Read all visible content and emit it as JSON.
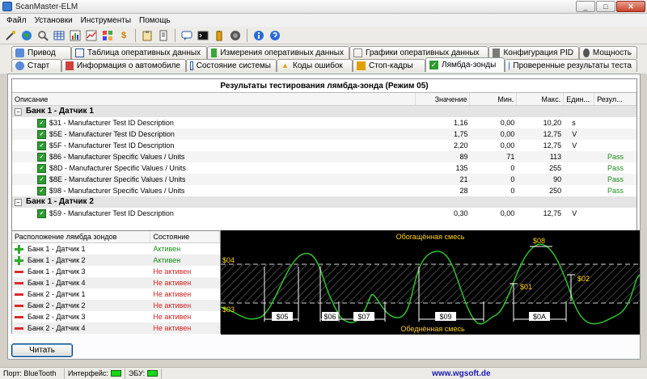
{
  "window": {
    "title": "ScanMaster-ELM",
    "controls": {
      "minimize": "_",
      "maximize": "□",
      "close": "✕"
    }
  },
  "menu": [
    "Файл",
    "Установки",
    "Инструменты",
    "Помощь"
  ],
  "tabs_row1": [
    {
      "label": "Привод",
      "icon": "drive-icon"
    },
    {
      "label": "Таблица оперативных данных",
      "icon": "table-icon"
    },
    {
      "label": "Измерения оперативных данных",
      "icon": "measure-icon"
    },
    {
      "label": "Графики оперативных данных",
      "icon": "chart-icon"
    },
    {
      "label": "Конфигурация PID",
      "icon": "config-icon"
    },
    {
      "label": "Мощность",
      "icon": "power-icon"
    }
  ],
  "tabs_row2": [
    {
      "label": "Старт",
      "icon": "start-icon"
    },
    {
      "label": "Информация о автомобиле",
      "icon": "car-info-icon"
    },
    {
      "label": "Состояние системы",
      "icon": "system-icon"
    },
    {
      "label": "Коды ошибок",
      "icon": "warning-icon"
    },
    {
      "label": "Стоп-кадры",
      "icon": "freeze-frame-icon"
    },
    {
      "label": "Лямбда-зонды",
      "icon": "lambda-icon",
      "active": true
    },
    {
      "label": "Проверенные результаты теста",
      "icon": "test-results-icon"
    }
  ],
  "grid": {
    "title": "Результаты тестирования лямбда-зонда (Режим 05)",
    "columns": {
      "desc": "Описание",
      "value": "Значение",
      "min": "Мин.",
      "max": "Макс.",
      "unit": "Един...",
      "result": "Резул..."
    },
    "groups": [
      {
        "name": "Банк 1 - Датчик 1",
        "expander": "−",
        "rows": [
          {
            "desc": "$31 - Manufacturer Test ID Description",
            "value": "1,16",
            "min": "0,00",
            "max": "10,20",
            "unit": "s",
            "result": ""
          },
          {
            "desc": "$5E - Manufacturer Test ID Description",
            "value": "1,75",
            "min": "0,00",
            "max": "12,75",
            "unit": "V",
            "result": ""
          },
          {
            "desc": "$5F - Manufacturer Test ID Description",
            "value": "2,20",
            "min": "0,00",
            "max": "12,75",
            "unit": "V",
            "result": ""
          },
          {
            "desc": "$86 - Manufacturer Specific Values / Units",
            "value": "89",
            "min": "71",
            "max": "113",
            "unit": "",
            "result": "Pass"
          },
          {
            "desc": "$8D - Manufacturer Specific Values / Units",
            "value": "135",
            "min": "0",
            "max": "255",
            "unit": "",
            "result": "Pass"
          },
          {
            "desc": "$8E - Manufacturer Specific Values / Units",
            "value": "21",
            "min": "0",
            "max": "90",
            "unit": "",
            "result": "Pass"
          },
          {
            "desc": "$98 - Manufacturer Specific Values / Units",
            "value": "28",
            "min": "0",
            "max": "250",
            "unit": "",
            "result": "Pass"
          }
        ]
      },
      {
        "name": "Банк 1 - Датчик 2",
        "expander": "−",
        "rows": [
          {
            "desc": "$59 - Manufacturer Test ID Description",
            "value": "0,30",
            "min": "0,00",
            "max": "12,75",
            "unit": "V",
            "result": ""
          }
        ]
      }
    ]
  },
  "sensors": {
    "headers": {
      "location": "Расположение лямбда зондов",
      "state": "Состояние"
    },
    "rows": [
      {
        "name": "Банк 1 - Датчик 1",
        "state": "Активен",
        "active": true
      },
      {
        "name": "Банк 1 - Датчик 2",
        "state": "Активен",
        "active": true
      },
      {
        "name": "Банк 1 - Датчик 3",
        "state": "Не активен",
        "active": false
      },
      {
        "name": "Банк 1 - Датчик 4",
        "state": "Не активен",
        "active": false
      },
      {
        "name": "Банк 2 - Датчик 1",
        "state": "Не активен",
        "active": false
      },
      {
        "name": "Банк 2 - Датчик 2",
        "state": "Не активен",
        "active": false
      },
      {
        "name": "Банк 2 - Датчик 3",
        "state": "Не активен",
        "active": false
      },
      {
        "name": "Банк 2 - Датчик 4",
        "state": "Не активен",
        "active": false
      }
    ],
    "colors": {
      "active": "#1a8c1a",
      "inactive": "#d42020"
    }
  },
  "diagram": {
    "rich_label": "Обогащённая смесь",
    "lean_label": "Обеднённая смесь",
    "level_labels": [
      "$04",
      "$03"
    ],
    "marker_labels": [
      "$08",
      "$01",
      "$02",
      "$05",
      "$06",
      "$07",
      "$09",
      "$0A"
    ],
    "colors": {
      "wave": "#2fc42f",
      "text": "#ffd400",
      "marker": "#ffffff",
      "hatch": "#6e6e6e"
    }
  },
  "read_button": "Читать",
  "status": {
    "port_label": "Порт: BlueTooth",
    "interface_label": "Интерфейс:",
    "ecu_label": "ЭБУ:",
    "link": "www.wgsoft.de",
    "led_color": "#16d816"
  }
}
